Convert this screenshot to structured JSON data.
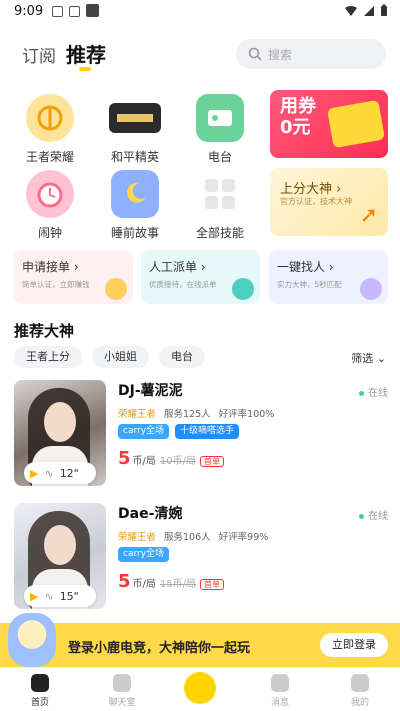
{
  "status": {
    "time": "9:09"
  },
  "header": {
    "tabs": [
      {
        "label": "订阅"
      },
      {
        "label": "推荐"
      }
    ],
    "search_placeholder": "搜索"
  },
  "grid": [
    {
      "label": "王者荣耀",
      "icon": "king-glory-icon"
    },
    {
      "label": "和平精英",
      "icon": "peace-elite-icon"
    },
    {
      "label": "电台",
      "icon": "radio-icon"
    },
    {
      "label": "闹钟",
      "icon": "alarm-clock-icon"
    },
    {
      "label": "睡前故事",
      "icon": "bedtime-story-icon"
    },
    {
      "label": "全部技能",
      "icon": "all-skills-icon"
    }
  ],
  "promo": {
    "text": "用券0元"
  },
  "dashen": {
    "title": "上分大神 ›",
    "sub": "官方认证，技术大神"
  },
  "cards": [
    {
      "title": "申请接单 ›",
      "sub": "简单认证，立即赚钱",
      "bg": "#fff0f2"
    },
    {
      "title": "人工派单 ›",
      "sub": "优质接待，在线派单",
      "bg": "#e6f8f7"
    },
    {
      "title": "一键找人 ›",
      "sub": "实力大神，5秒匹配",
      "bg": "#eef1ff"
    }
  ],
  "section": {
    "title": "推荐大神",
    "sort": "筛选"
  },
  "filters": [
    "王者上分",
    "小姐姐",
    "电台"
  ],
  "players": [
    {
      "name": "DJ-薯泥泥",
      "online": "在线",
      "rank": "荣耀王者",
      "served": "服务125人",
      "rate": "好评率100%",
      "tags": [
        "carry全场",
        "十级嘀嗒选手"
      ],
      "price": "5",
      "unit": "币/局",
      "old": "10币/局",
      "badge": "首单",
      "voice": "12\""
    },
    {
      "name": "Dae-清婉",
      "online": "在线",
      "rank": "荣耀王者",
      "served": "服务106人",
      "rate": "好评率99%",
      "tags": [
        "carry全场"
      ],
      "price": "5",
      "unit": "币/局",
      "old": "15币/局",
      "badge": "首单",
      "voice": "15\""
    }
  ],
  "banner": {
    "text": "登录小鹿电竞，大神陪你一起玩",
    "button": "立即登录"
  },
  "nav": [
    {
      "label": "首页"
    },
    {
      "label": "聊天室"
    },
    {
      "label": ""
    },
    {
      "label": "消息"
    },
    {
      "label": "我的"
    }
  ],
  "colors": {
    "accent": "#FFD400",
    "price": "#FF3434",
    "online": "#3CCF9A",
    "tag": "#3AA6FF"
  }
}
